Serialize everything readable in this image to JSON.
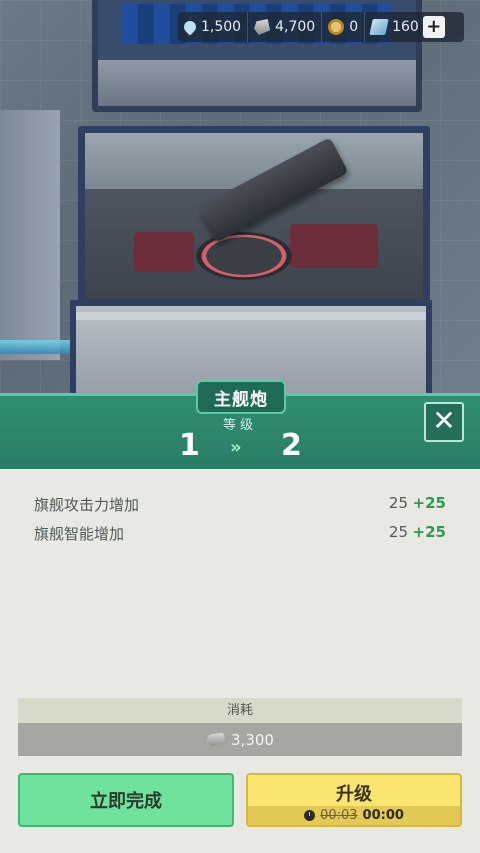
{
  "resources": [
    {
      "icon": "water-drop-icon",
      "value": "1,500"
    },
    {
      "icon": "metal-ingot-icon",
      "value": "4,700"
    },
    {
      "icon": "gold-coin-icon",
      "value": "0"
    },
    {
      "icon": "blueprint-card-icon",
      "value": "160"
    }
  ],
  "add_button": "+",
  "panel": {
    "title": "主舰炮",
    "level_label": "等级",
    "level_from": "1",
    "level_arrow": "»",
    "level_to": "2",
    "close": "✕"
  },
  "stats": [
    {
      "label": "旗舰攻击力增加",
      "value": "25",
      "increase": "+25"
    },
    {
      "label": "旗舰智能增加",
      "value": "25",
      "increase": "+25"
    }
  ],
  "cost": {
    "title": "消耗",
    "icon": "metal-ingot-icon",
    "value": "3,300"
  },
  "buttons": {
    "finish_now": "立即完成",
    "upgrade": "升级",
    "time_old": "00:03",
    "time_new": "00:00"
  },
  "colors": {
    "panel_green": "#2a7d66",
    "finish_green": "#6fe39d",
    "upgrade_yellow": "#f9e56f",
    "increase_green": "#2e9a4c"
  }
}
